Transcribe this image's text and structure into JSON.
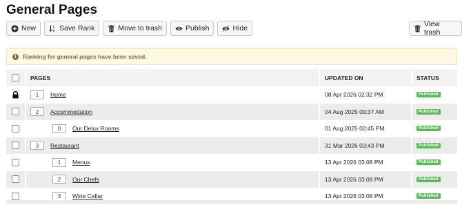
{
  "page_title": "General Pages",
  "toolbar": {
    "new": "New",
    "save_rank": "Save Rank",
    "move_to_trash": "Move to trash",
    "publish": "Publish",
    "hide": "Hide",
    "view_trash": "View trash"
  },
  "alert": "Ranking for general pages have been saved.",
  "table": {
    "headers": {
      "pages": "PAGES",
      "updated_on": "UPDATED ON",
      "status": "STATUS"
    },
    "rows": [
      {
        "rank": "1",
        "name": "Home",
        "updated": "08 Apr 2026 02:32 PM",
        "status": "Published",
        "locked": true,
        "level": 0
      },
      {
        "rank": "2",
        "name": "Accommodation",
        "updated": "04 Aug 2025 09:37 AM",
        "status": "Published",
        "locked": false,
        "level": 0
      },
      {
        "rank": "0",
        "name": "Our Delux Rooms",
        "updated": "01 Aug 2025 02:45 PM",
        "status": "Published",
        "locked": false,
        "level": 1
      },
      {
        "rank": "3",
        "name": "Restaurant",
        "updated": "31 Mar 2026 03:43 PM",
        "status": "Published",
        "locked": false,
        "level": 0
      },
      {
        "rank": "1",
        "name": "Menus",
        "updated": "13 Apr 2026 03:08 PM",
        "status": "Published",
        "locked": false,
        "level": 1
      },
      {
        "rank": "2",
        "name": "Our Chefs",
        "updated": "13 Apr 2026 03:08 PM",
        "status": "Published",
        "locked": false,
        "level": 1
      },
      {
        "rank": "3",
        "name": "Wine Cellar",
        "updated": "13 Apr 2026 03:08 PM",
        "status": "Published",
        "locked": false,
        "level": 1
      }
    ]
  },
  "colors": {
    "published_badge": "#5cb85c",
    "alert_bg": "#fcf8e3",
    "alert_text": "#8a6d3b"
  }
}
